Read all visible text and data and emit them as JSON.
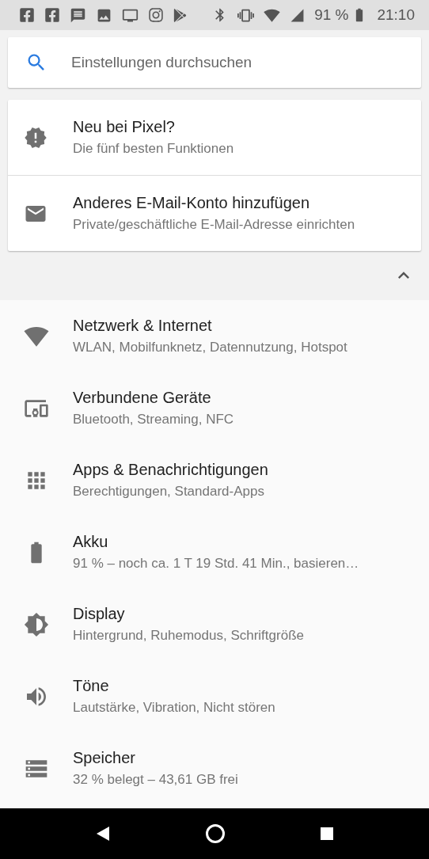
{
  "status_bar": {
    "battery": "91 %",
    "time": "21:10"
  },
  "search": {
    "placeholder": "Einstellungen durchsuchen"
  },
  "suggestions": {
    "expanded": true,
    "items": [
      {
        "title": "Neu bei Pixel?",
        "subtitle": "Die fünf besten Funktionen"
      },
      {
        "title": "Anderes E-Mail-Konto hinzufügen",
        "subtitle": "Private/geschäftliche E-Mail-Adresse einrichten"
      }
    ]
  },
  "settings": [
    {
      "title": "Netzwerk & Internet",
      "subtitle": "WLAN, Mobilfunknetz, Datennutzung, Hotspot"
    },
    {
      "title": "Verbundene Geräte",
      "subtitle": "Bluetooth, Streaming, NFC"
    },
    {
      "title": "Apps & Benachrichtigungen",
      "subtitle": "Berechtigungen, Standard-Apps"
    },
    {
      "title": "Akku",
      "subtitle": "91 % – noch ca. 1 T 19 Std. 41 Min., basieren…"
    },
    {
      "title": "Display",
      "subtitle": "Hintergrund, Ruhemodus, Schriftgröße"
    },
    {
      "title": "Töne",
      "subtitle": "Lautstärke, Vibration, Nicht stören"
    },
    {
      "title": "Speicher",
      "subtitle": "32 % belegt – 43,61 GB frei"
    }
  ]
}
